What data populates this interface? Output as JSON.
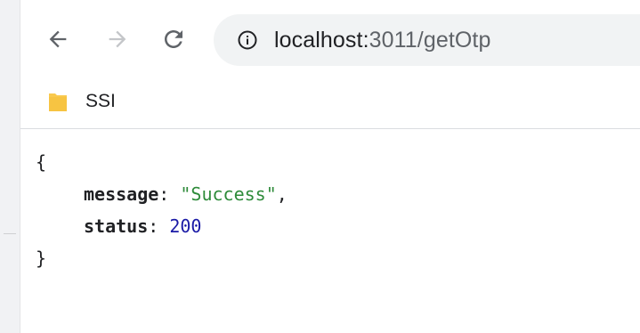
{
  "browser": {
    "nav": {
      "back_icon": "arrow-left-icon",
      "forward_icon": "arrow-right-icon",
      "reload_icon": "reload-icon"
    },
    "address_bar": {
      "info_icon": "info-circle-icon",
      "host": "localhost:",
      "path": "3011/getOtp"
    },
    "bookmarks": [
      {
        "label": "SSI",
        "icon": "folder-icon",
        "color": "#f9c94e"
      }
    ]
  },
  "response": {
    "open_brace": "{",
    "close_brace": "}",
    "fields": [
      {
        "key": "message",
        "separator": ": ",
        "value": "\"Success\"",
        "trailing": ","
      },
      {
        "key": "status",
        "separator": ": ",
        "value": "200",
        "trailing": ""
      }
    ]
  },
  "colors": {
    "string": "#2e8b3a",
    "number": "#1a1aa6",
    "omnibox_bg": "#f1f3f4",
    "icon": "#5f6368"
  }
}
